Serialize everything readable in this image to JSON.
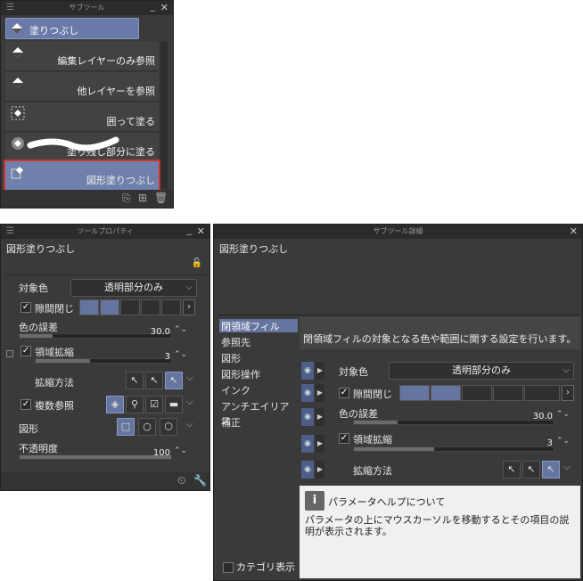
{
  "subtool_panel": {
    "title": "サブツール",
    "header_label": "塗りつぶし",
    "items": [
      {
        "label": "編集レイヤーのみ参照",
        "icon": "bucket-icon"
      },
      {
        "label": "他レイヤーを参照",
        "icon": "bucket-icon"
      },
      {
        "label": "囲って塗る",
        "icon": "enclose-fill-icon"
      },
      {
        "label": "塗り残し部分に塗る",
        "icon": "fill-unfilled-icon"
      },
      {
        "label": "図形塗りつぶし",
        "icon": "shape-fill-icon",
        "selected": true
      }
    ]
  },
  "tool_property": {
    "title": "ツールプロパティ",
    "tool_name": "図形塗りつぶし",
    "target_color_label": "対象色",
    "target_color_value": "透明部分のみ",
    "gap_close_label": "隙間閉じ",
    "gap_close_checked": true,
    "color_margin_label": "色の誤差",
    "color_margin_value": "30.0",
    "area_scaling_label": "領域拡縮",
    "area_scaling_checked": true,
    "area_scaling_value": "3",
    "scaling_method_label": "拡縮方法",
    "multiple_ref_label": "複数参照",
    "multiple_ref_checked": true,
    "shape_label": "図形",
    "opacity_label": "不透明度",
    "opacity_value": "100"
  },
  "subtool_detail": {
    "title": "サブツール詳細",
    "tool_name": "図形塗りつぶし",
    "categories": [
      "閉領域フィル",
      "参照先",
      "図形",
      "図形操作",
      "インク",
      "アンチエイリアス",
      "補正"
    ],
    "active_category": 0,
    "category_display_label": "カテゴリ表示",
    "description": "閉領域フィルの対象となる色や範囲に関する設定を行います。",
    "target_color_label": "対象色",
    "target_color_value": "透明部分のみ",
    "gap_close_label": "隙間閉じ",
    "color_margin_label": "色の誤差",
    "color_margin_value": "30.0",
    "area_scaling_label": "領域拡縮",
    "area_scaling_value": "3",
    "scaling_method_label": "拡縮方法",
    "help_title": "パラメータヘルプについて",
    "help_text": "パラメータの上にマウスカーソルを移動するとその項目の説明が表示されます。"
  },
  "colors": {
    "accent": "#6675a0",
    "panel": "#3a3a3a",
    "highlight_border": "#d43030"
  }
}
